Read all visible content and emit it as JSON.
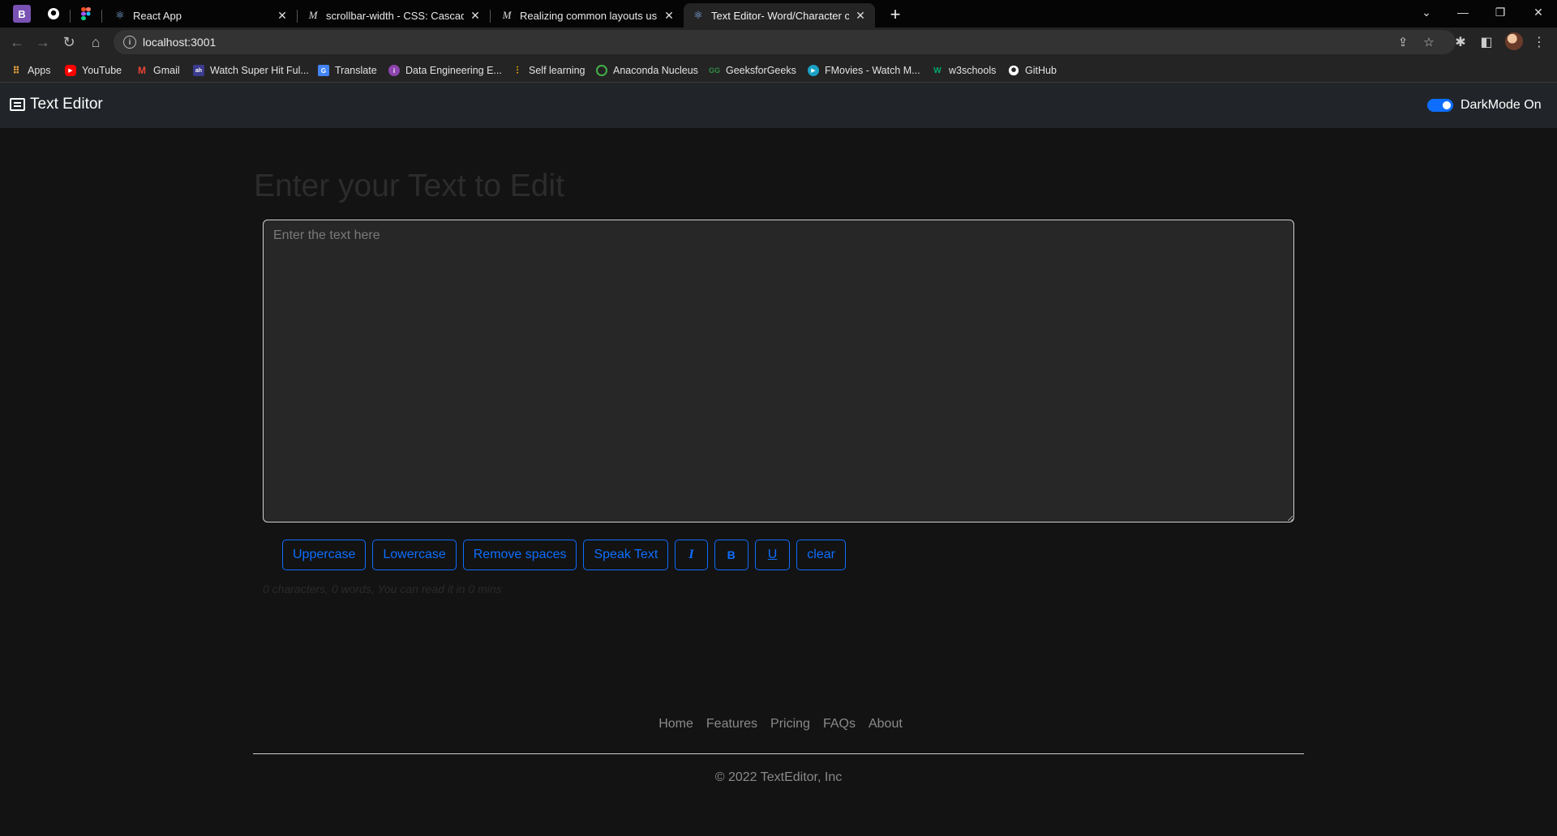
{
  "browser": {
    "tabs": [
      {
        "title": "React App",
        "icon": "react-icon",
        "active": false
      },
      {
        "title": "scrollbar-width - CSS: Cascading",
        "icon": "mdn-icon",
        "active": false
      },
      {
        "title": "Realizing common layouts using",
        "icon": "mdn-icon",
        "active": false
      },
      {
        "title": "Text Editor- Word/Character cou",
        "icon": "react-icon",
        "active": true
      }
    ],
    "url": "localhost:3001",
    "bookmarks": [
      {
        "label": "Apps",
        "icon": "apps-grid-icon",
        "color": "#e8a33d"
      },
      {
        "label": "YouTube",
        "icon": "youtube-icon",
        "color": "#ff0000"
      },
      {
        "label": "Gmail",
        "icon": "gmail-icon",
        "color": "#ea4335"
      },
      {
        "label": "Watch Super Hit Ful...",
        "icon": "site-icon",
        "color": "#3b3b8f"
      },
      {
        "label": "Translate",
        "icon": "translate-icon",
        "color": "#4285f4"
      },
      {
        "label": "Data Engineering E...",
        "icon": "site-icon",
        "color": "#8e44ad"
      },
      {
        "label": "Self learning",
        "icon": "bar-chart-icon",
        "color": "#f4b400"
      },
      {
        "label": "Anaconda Nucleus",
        "icon": "anaconda-icon",
        "color": "#43b049"
      },
      {
        "label": "GeeksforGeeks",
        "icon": "gfg-icon",
        "color": "#2f8d46"
      },
      {
        "label": "FMovies - Watch M...",
        "icon": "play-icon",
        "color": "#1ba1c6"
      },
      {
        "label": "w3schools",
        "icon": "w3-icon",
        "color": "#04aa6d"
      },
      {
        "label": "GitHub",
        "icon": "github-icon",
        "color": "#ffffff"
      }
    ]
  },
  "app": {
    "brand": "Text Editor",
    "dark_mode_label": "DarkMode On",
    "dark_mode_on": true,
    "heading": "Enter your Text to Edit",
    "textarea_placeholder": "Enter the text here",
    "buttons": {
      "uppercase": "Uppercase",
      "lowercase": "Lowercase",
      "remove_spaces": "Remove spaces",
      "speak": "Speak Text",
      "italic": "I",
      "bold": "B",
      "underline": "U",
      "clear": "clear"
    },
    "summary": "0 characters, 0 words, You can read it in 0 mins",
    "footer_links": [
      "Home",
      "Features",
      "Pricing",
      "FAQs",
      "About"
    ],
    "copyright": "© 2022 TextEditor, Inc"
  },
  "colors": {
    "accent": "#0d6efd",
    "navbar": "#212529",
    "page_bg": "#131313"
  }
}
